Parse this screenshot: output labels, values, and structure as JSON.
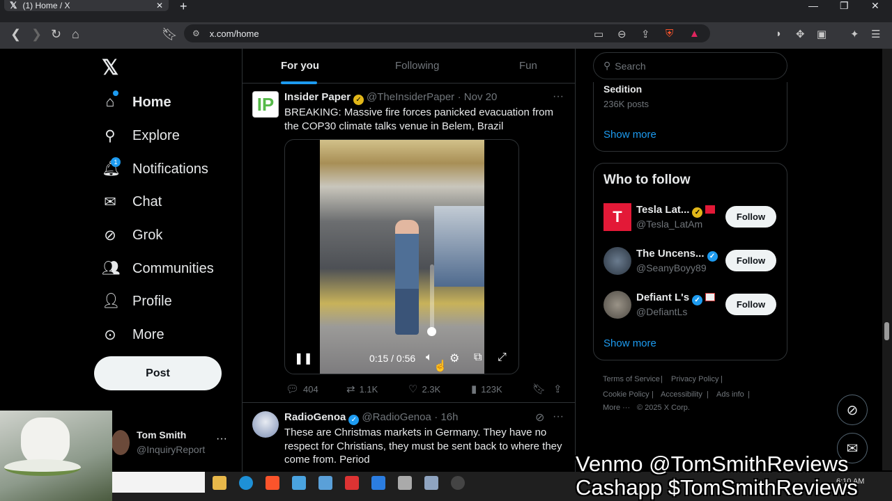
{
  "browser": {
    "tab_title": "(1) Home / X",
    "url": "x.com/home"
  },
  "sidebar": {
    "items": [
      {
        "label": "Home",
        "icon": "home-icon"
      },
      {
        "label": "Explore",
        "icon": "search-icon"
      },
      {
        "label": "Notifications",
        "icon": "bell-icon",
        "badge": "1"
      },
      {
        "label": "Chat",
        "icon": "mail-icon"
      },
      {
        "label": "Grok",
        "icon": "grok-icon"
      },
      {
        "label": "Communities",
        "icon": "people-icon"
      },
      {
        "label": "Profile",
        "icon": "person-icon"
      },
      {
        "label": "More",
        "icon": "more-circle-icon"
      }
    ],
    "post_label": "Post",
    "account": {
      "name": "Tom Smith",
      "handle": "@InquiryReport"
    }
  },
  "feed": {
    "tabs": [
      "For you",
      "Following",
      "Fun"
    ],
    "posts": [
      {
        "avatar_text": "IP",
        "name": "Insider Paper",
        "handle": "@TheInsiderPaper",
        "date": "· Nov 20",
        "text": "BREAKING: Massive fire forces panicked evacuation from the COP30 climate talks venue in Belem, Brazil",
        "video_time": "0:15 / 0:56",
        "replies": "404",
        "reposts": "1.1K",
        "likes": "2.3K",
        "views": "123K"
      },
      {
        "name": "RadioGenoa",
        "handle": "@RadioGenoa",
        "date": "· 16h",
        "text": "These are Christmas markets in Germany. They have no respect for Christians, they must be sent back to where they come from. Period"
      }
    ]
  },
  "right": {
    "search_placeholder": "Search",
    "trend": {
      "name": "Sedition",
      "posts": "236K posts",
      "show_more": "Show more"
    },
    "who_to_follow": {
      "title": "Who to follow",
      "accounts": [
        {
          "name": "Tesla Lat...",
          "handle": "@Tesla_LatAm"
        },
        {
          "name": "The Uncens...",
          "handle": "@SeanyBoyy89"
        },
        {
          "name": "Defiant L's",
          "handle": "@DefiantLs"
        }
      ],
      "follow_label": "Follow",
      "show_more": "Show more"
    },
    "footer": [
      "Terms of Service",
      "Privacy Policy",
      "Cookie Policy",
      "Accessibility",
      "Ads info",
      "More ···",
      "© 2025 X Corp."
    ]
  },
  "overlay": {
    "line1": "Venmo @TomSmithReviews",
    "line2": "Cashapp $TomSmithReviews"
  },
  "taskbar": {
    "clock": "6:10 AM"
  },
  "colors": {
    "accent": "#1d9bf0",
    "gold": "#e2b719",
    "bg": "#000000"
  }
}
